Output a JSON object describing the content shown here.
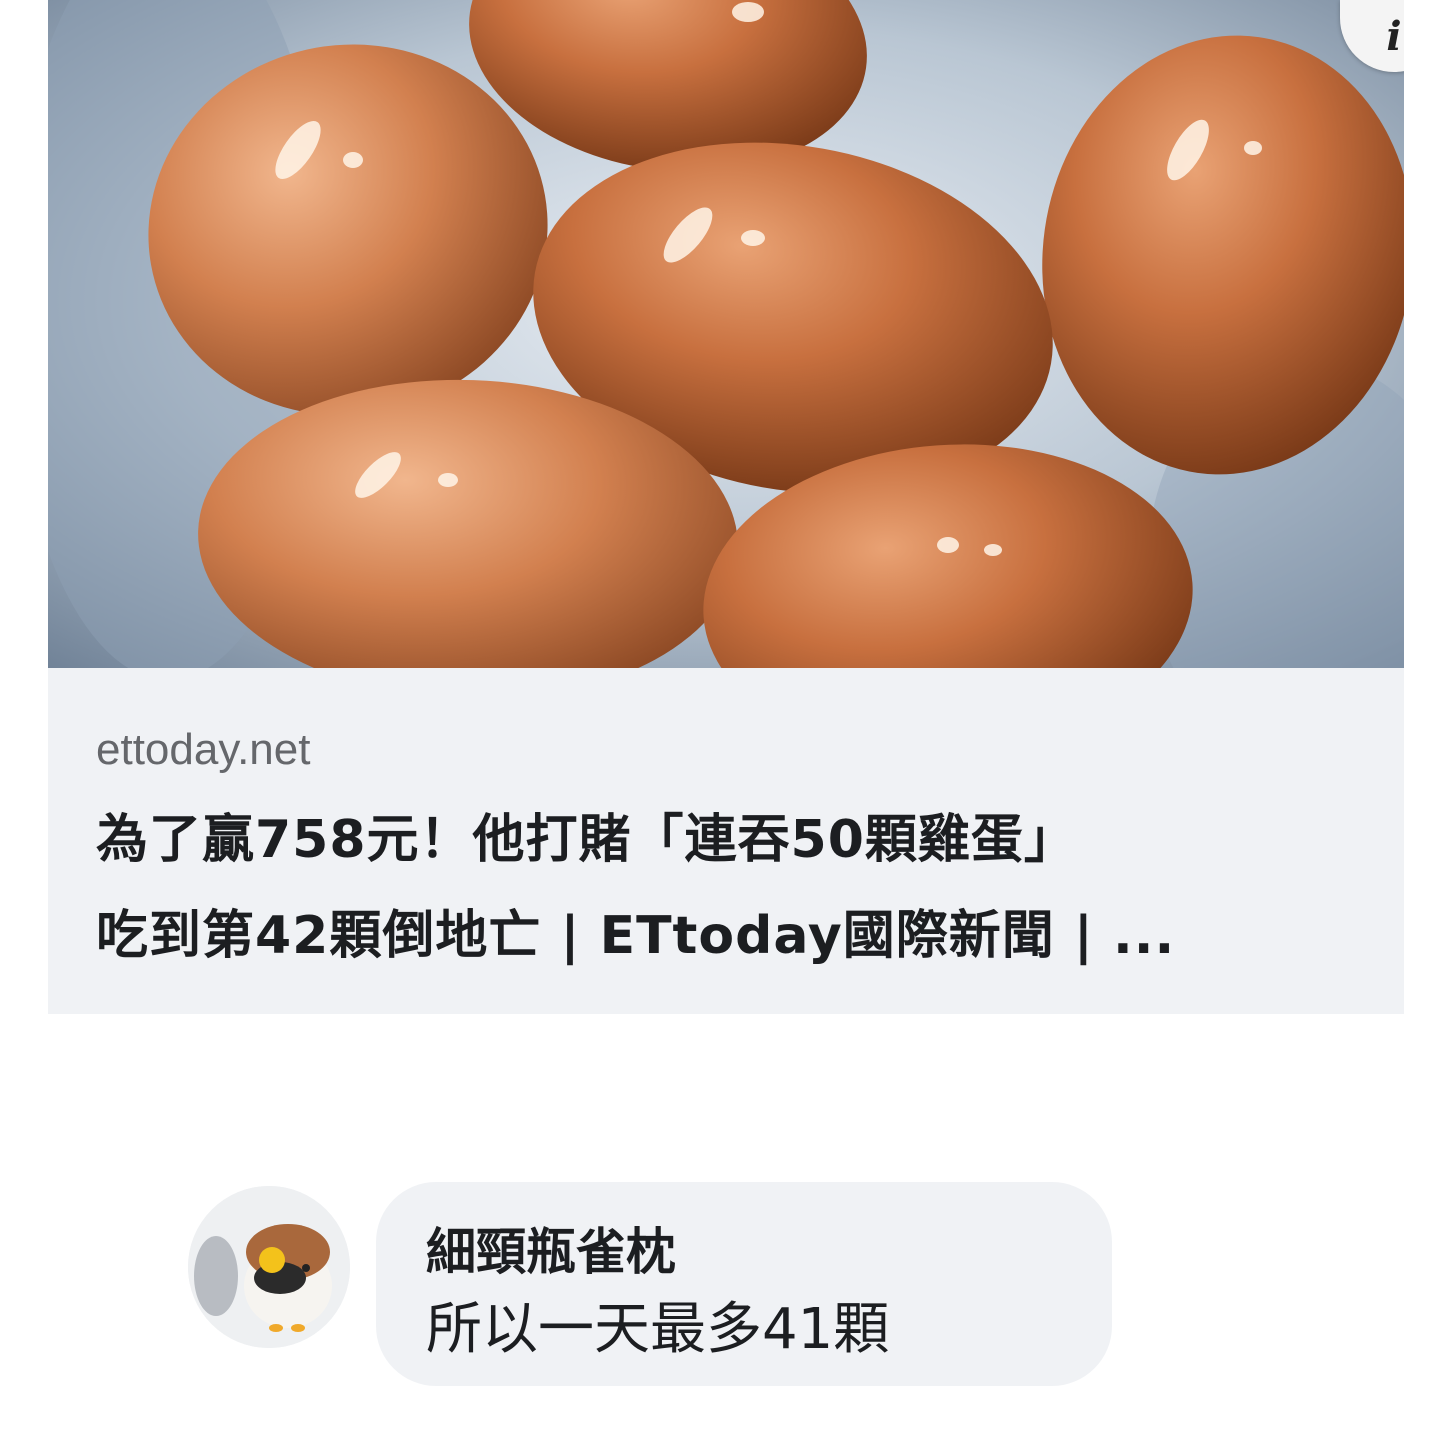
{
  "link_preview": {
    "domain": "ettoday.net",
    "title_line_1": "為了贏758元！他打賭「連吞50顆雞蛋」",
    "title_line_2": "吃到第42顆倒地亡 | ETtoday國際新聞 | ...",
    "info_glyph": "i",
    "image_description_icon": "eggs-photo"
  },
  "comment": {
    "author": "細頸瓶雀枕",
    "text": "所以一天最多41顆"
  },
  "colors": {
    "card_background": "#f0f2f5",
    "bubble_background": "#f0f2f5",
    "text_primary": "#1c1e21",
    "text_secondary": "#65676b"
  }
}
